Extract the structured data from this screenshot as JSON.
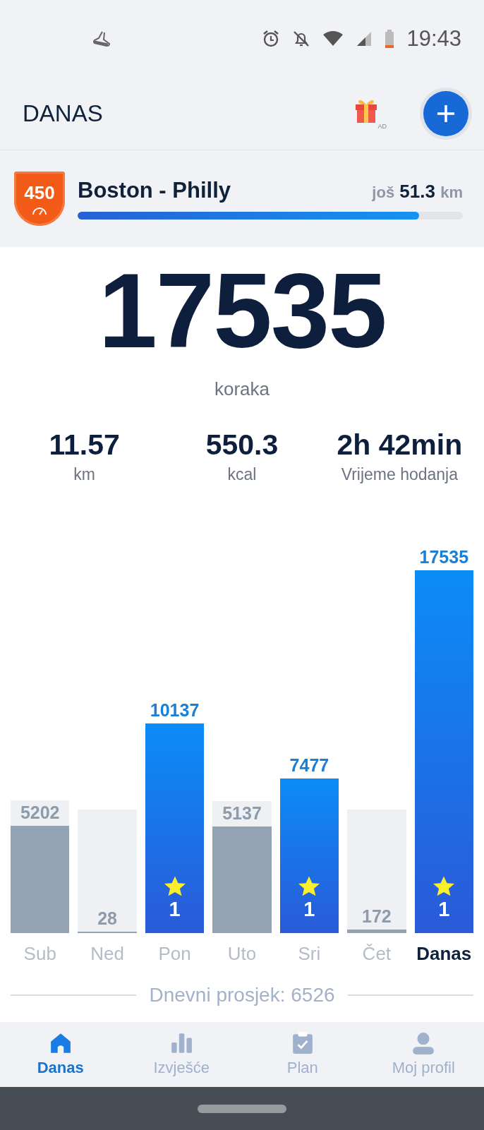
{
  "status_bar": {
    "time": "19:43"
  },
  "header": {
    "title": "DANAS",
    "ad_label": "AD"
  },
  "challenge": {
    "badge": "450",
    "title": "Boston - Philly",
    "remaining_prefix": "još",
    "remaining_value": "51.3",
    "remaining_unit": "km",
    "level": 0.886
  },
  "steps": {
    "value": "17535",
    "unit": "koraka"
  },
  "stats": [
    {
      "value": "11.57",
      "label": "km"
    },
    {
      "value": "550.3",
      "label": "kcal"
    },
    {
      "value": "2h 42min",
      "label": "Vrijeme hodanja"
    }
  ],
  "days": [
    {
      "label": "Sub",
      "steps": "5202",
      "goal_reached": false,
      "selected": false
    },
    {
      "label": "Ned",
      "steps": "28",
      "goal_reached": false,
      "selected": false
    },
    {
      "label": "Pon",
      "steps": "10137",
      "goal_reached": true,
      "star_count": "1",
      "selected": false
    },
    {
      "label": "Uto",
      "steps": "5137",
      "goal_reached": false,
      "selected": false
    },
    {
      "label": "Sri",
      "steps": "7477",
      "goal_reached": true,
      "star_count": "1",
      "selected": false
    },
    {
      "label": "Čet",
      "steps": "172",
      "goal_reached": false,
      "selected": false
    },
    {
      "label": "Danas",
      "steps": "17535",
      "goal_reached": true,
      "star_count": "1",
      "selected": true
    }
  ],
  "average": "Dnevni prosjek: 6526",
  "nav": [
    {
      "label": "Danas",
      "kind": "home",
      "selected": true
    },
    {
      "label": "Izvješće",
      "kind": "report",
      "selected": false
    },
    {
      "label": "Plan",
      "kind": "plan",
      "selected": false
    },
    {
      "label": "Moj profil",
      "kind": "profile",
      "selected": false
    }
  ]
}
